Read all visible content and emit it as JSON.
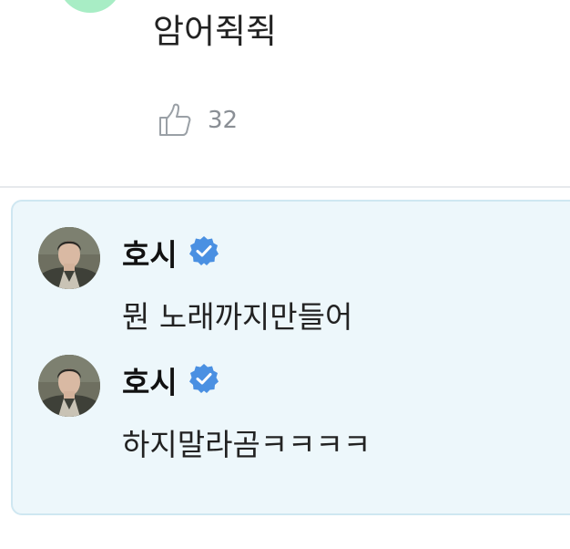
{
  "comment": {
    "text": "암어쥑쥑",
    "like_count": "32",
    "icons": {
      "like": "thumbs-up-icon"
    }
  },
  "artist_replies": [
    {
      "name": "호시",
      "verified_icon": "verified-badge-icon",
      "text": "뭔 노래까지만들어"
    },
    {
      "name": "호시",
      "verified_icon": "verified-badge-icon",
      "text": "하지말라곰ㅋㅋㅋㅋ"
    }
  ],
  "colors": {
    "verified_badge": "#4a90e2",
    "reply_background": "#edf7fb",
    "reply_border": "#cfe7f1",
    "user_avatar": "#a8edc5"
  }
}
